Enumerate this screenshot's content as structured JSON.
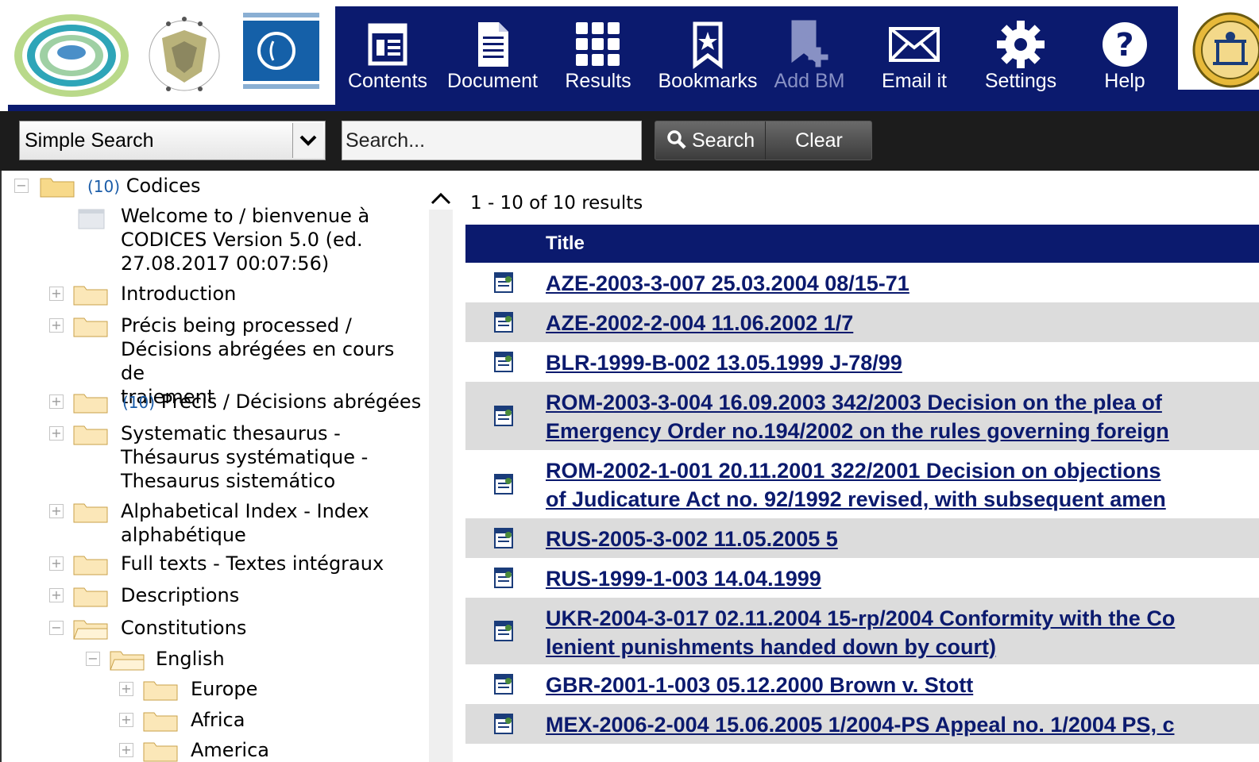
{
  "toolbar": {
    "items": [
      {
        "label": "Contents",
        "icon": "contents-icon"
      },
      {
        "label": "Document",
        "icon": "document-icon"
      },
      {
        "label": "Results",
        "icon": "results-grid-icon"
      },
      {
        "label": "Bookmarks",
        "icon": "bookmark-icon"
      },
      {
        "label": "Add BM",
        "icon": "add-bookmark-icon",
        "disabled": true
      },
      {
        "label": "Email it",
        "icon": "envelope-icon"
      },
      {
        "label": "Settings",
        "icon": "gear-icon"
      },
      {
        "label": "Help",
        "icon": "help-icon"
      }
    ],
    "colors": {
      "background": "#0b1a6e",
      "text": "#ffffff",
      "disabled_text": "#8891c4"
    }
  },
  "search": {
    "mode_selected": "Simple Search",
    "placeholder": "Search...",
    "search_label": "Search",
    "clear_label": "Clear"
  },
  "tree": {
    "root": {
      "count": "(10)",
      "label": "Codices"
    },
    "welcome": "Welcome to / bienvenue à\nCODICES Version 5.0 (ed.\n27.08.2017 00:07:56)",
    "items": [
      {
        "label": "Introduction"
      },
      {
        "label": "Précis being processed /\nDécisions abrégées en cours de\ntraiement"
      },
      {
        "count": "(10)",
        "label": "Précis / Décisions abrégées"
      },
      {
        "label": "Systematic thesaurus -\nThésaurus systématique -\nThesaurus sistemático"
      },
      {
        "label": "Alphabetical Index - Index\nalphabétique"
      },
      {
        "label": "Full texts - Textes intégraux"
      },
      {
        "label": "Descriptions"
      },
      {
        "label": "Constitutions"
      }
    ],
    "english": "English",
    "sub": [
      "Europe",
      "Africa",
      "America"
    ]
  },
  "results": {
    "count_text": "1 - 10 of 10 results",
    "column_title": "Title",
    "rows": [
      {
        "title": "AZE-2003-3-007 25.03.2004 08/15-71"
      },
      {
        "title": "AZE-2002-2-004 11.06.2002 1/7"
      },
      {
        "title": "BLR-1999-B-002 13.05.1999 J-78/99"
      },
      {
        "title": "ROM-2003-3-004 16.09.2003 342/2003 Decision on the plea of\nEmergency Order no.194/2002 on the rules governing foreign"
      },
      {
        "title": "ROM-2002-1-001 20.11.2001 322/2001 Decision on objections\nof Judicature Act no. 92/1992 revised, with subsequent amen"
      },
      {
        "title": "RUS-2005-3-002 11.05.2005 5"
      },
      {
        "title": "RUS-1999-1-003 14.04.1999"
      },
      {
        "title": "UKR-2004-3-017 02.11.2004 15-rp/2004 Conformity with the Co\nlenient punishments handed down by court)"
      },
      {
        "title": "GBR-2001-1-003 05.12.2000 Brown v. Stott"
      },
      {
        "title": "MEX-2006-2-004 15.06.2005 1/2004-PS Appeal no. 1/2004 PS, c"
      }
    ]
  }
}
